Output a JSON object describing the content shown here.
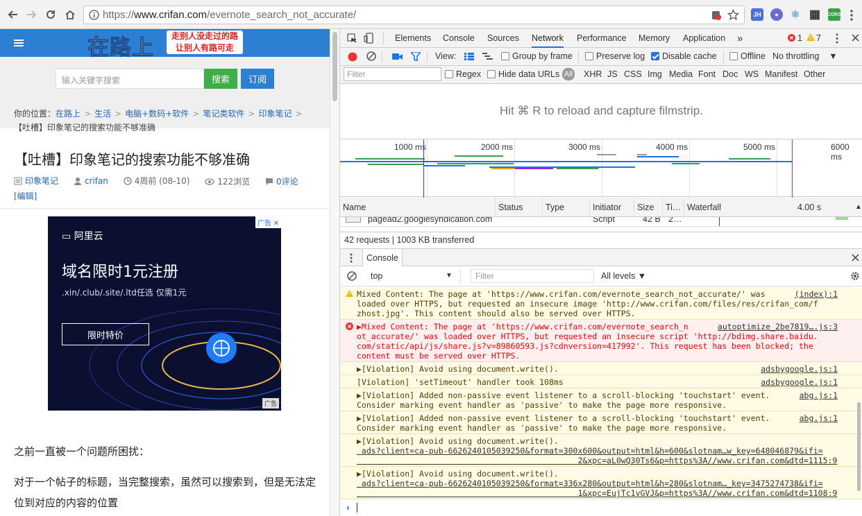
{
  "browser": {
    "url_prefix": "https://",
    "url_domain": "www.crifan.com",
    "url_path": "/evernote_search_not_accurate/",
    "extensions": [
      {
        "icon": "jh-extension-icon",
        "label": "JH",
        "color": "#4a6fd8"
      },
      {
        "icon": "globe-extension-icon",
        "label": "●",
        "color": "#6b6bd8"
      },
      {
        "icon": "react-extension-icon",
        "label": "⚛",
        "color": "#ffffff"
      },
      {
        "icon": "qr-extension-icon",
        "label": "▦",
        "color": "#333333"
      },
      {
        "icon": "cors-extension-icon",
        "label": "CORS",
        "color": "#3aa04a"
      }
    ]
  },
  "page": {
    "logo_main": "在路上",
    "logo_tag_line1": "走别人没走过的路",
    "logo_tag_line2": "让别人有路可走",
    "search_placeholder": "输入关键字搜索",
    "search_button": "搜索",
    "subscribe_button": "订阅",
    "breadcrumb": {
      "prefix": "你的位置：",
      "items": [
        "在路上",
        "生活",
        "电脑+数码+软件",
        "笔记类软件",
        "印象笔记"
      ],
      "current": "【吐槽】印象笔记的搜索功能不够准确"
    },
    "title": "【吐槽】印象笔记的搜索功能不够准确",
    "meta": {
      "category": "印象笔记",
      "author": "crifan",
      "date": "4周前 (08-10)",
      "views": "122浏览",
      "comments": "0评论",
      "edit": "[编辑]"
    },
    "ad": {
      "badge": "广告",
      "brand": "阿里云",
      "headline": "域名限时1元注册",
      "subline": ".xin/.club/.site/.ltd任选 仅需1元",
      "cta": "限时特价",
      "footer": "广告"
    },
    "paragraph1": "之前一直被一个问题所困扰：",
    "paragraph2": "对于一个帖子的标题，当完整搜索，虽然可以搜索到，但是无法定位到对应的内容的位置"
  },
  "devtools": {
    "tabs": [
      "Elements",
      "Console",
      "Sources",
      "Network",
      "Performance",
      "Memory",
      "Application"
    ],
    "active_tab": "Network",
    "more": "»",
    "errors": "1",
    "warnings": "7",
    "view_label": "View:",
    "group_by_frame": "Group by frame",
    "preserve_log": "Preserve log",
    "disable_cache": "Disable cache",
    "offline": "Offline",
    "throttling": "No throttling",
    "filter_placeholder": "Filter",
    "regex": "Regex",
    "hide_data_urls": "Hide data URLs",
    "all": "All",
    "types": [
      "XHR",
      "JS",
      "CSS",
      "Img",
      "Media",
      "Font",
      "Doc",
      "WS",
      "Manifest",
      "Other"
    ],
    "filmstrip_hint": "Hit ⌘ R to reload and capture filmstrip.",
    "timeline_ticks": [
      "1000 ms",
      "2000 ms",
      "3000 ms",
      "4000 ms",
      "5000 ms",
      "6000 ms"
    ],
    "columns": [
      "Name",
      "Status",
      "Type",
      "Initiator",
      "Size",
      "Ti…",
      "Waterfall"
    ],
    "waterfall_time": "4.00 s",
    "request": {
      "name": "pagead2.googlesyndication.com",
      "initiator": "Script",
      "size": "42 B",
      "time": "2…"
    },
    "summary": "42 requests | 1003 KB transferred",
    "console_tab": "Console",
    "context": "top",
    "console_filter": "Filter",
    "levels": "All levels ▼",
    "messages": [
      {
        "kind": "warn",
        "lines": [
          "Mixed Content: The page at 'https://www.crifan.com/evernote_search_not_accurate/' was",
          "loaded over HTTPS, but requested an insecure image 'http://www.crifan.com/files/res/crifan_com/f",
          "zhost.jpg'. This content should also be served over HTTPS."
        ],
        "source": "(index):1"
      },
      {
        "kind": "err",
        "lines": [
          "▶Mixed Content: The page at 'https://www.crifan.com/evernote_search_n",
          "ot_accurate/' was loaded over HTTPS, but requested an insecure script 'http://bdimg.share.baidu.",
          "com/static/api/js/share.js?v=89860593.js?cdnversion=417992'. This request has been blocked; the",
          "content must be served over HTTPS."
        ],
        "source": "autoptimize_2be7819….js:3"
      },
      {
        "kind": "warn",
        "lines": [
          "▶[Violation] Avoid using document.write()."
        ],
        "source": "adsbygoogle.js:1"
      },
      {
        "kind": "warn",
        "lines": [
          "[Violation] 'setTimeout' handler took 108ms"
        ],
        "source": "adsbygoogle.js:1"
      },
      {
        "kind": "warn",
        "lines": [
          "▶[Violation] Added non-passive event listener to a scroll-blocking 'touchstart' event.",
          "Consider marking event handler as 'passive' to make the page more responsive."
        ],
        "source": "abg.js:1"
      },
      {
        "kind": "warn",
        "lines": [
          "▶[Violation] Added non-passive event listener to a scroll-blocking 'touchstart' event.",
          "Consider marking event handler as 'passive' to make the page more responsive."
        ],
        "source": "abg.js:1"
      },
      {
        "kind": "warn",
        "lines": [
          "▶[Violation] Avoid using document.write().",
          " ads?client=ca-pub-6626240105039250&format=300x600&output=html&h=600&slotnam…w_key=648046879&ifi=",
          "                                              2&xpc=aL0wQ30Ts6&p=https%3A//www.crifan.com&dtd=1115:9"
        ],
        "source": ""
      },
      {
        "kind": "warn",
        "lines": [
          "▶[Violation] Avoid using document.write().",
          " ads?client=ca-pub-6626240105039250&format=336x280&output=html&h=280&slotnam…_key=3475274738&ifi=",
          "                                              1&xpc=EujTc1vGVJ&p=https%3A//www.crifan.com&dtd=1108:9"
        ],
        "source": ""
      }
    ],
    "prompt": "›"
  }
}
